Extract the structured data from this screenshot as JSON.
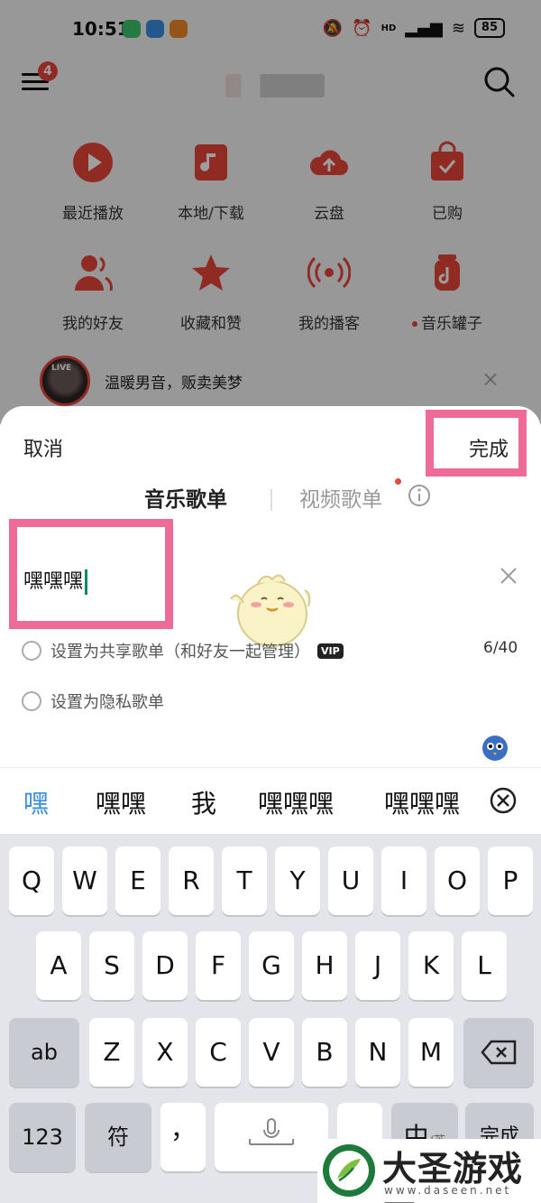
{
  "status_bar": {
    "time": "10:51",
    "battery": "85",
    "network": "HD"
  },
  "nav": {
    "badge_count": "4"
  },
  "grid": {
    "items": [
      {
        "label": "最近播放",
        "icon": "play-circle-icon"
      },
      {
        "label": "本地/下载",
        "icon": "music-note-folder-icon"
      },
      {
        "label": "云盘",
        "icon": "cloud-upload-icon"
      },
      {
        "label": "已购",
        "icon": "shopping-bag-check-icon"
      },
      {
        "label": "我的好友",
        "icon": "friends-icon"
      },
      {
        "label": "收藏和赞",
        "icon": "star-icon"
      },
      {
        "label": "我的播客",
        "icon": "broadcast-icon"
      },
      {
        "label": "音乐罐子",
        "icon": "music-jar-icon"
      }
    ]
  },
  "live": {
    "tag": "LIVE",
    "text": "温暖男音，贩卖美梦"
  },
  "sheet": {
    "cancel_label": "取消",
    "done_label": "完成",
    "tab_music": "音乐歌单",
    "tab_video": "视频歌单",
    "input_value": "嘿嘿嘿",
    "option_shared": "设置为共享歌单（和好友一起管理）",
    "vip_badge": "VIP",
    "option_private": "设置为隐私歌单",
    "char_count": "6/40"
  },
  "candidates": [
    "嘿",
    "嘿嘿",
    "我",
    "嘿嘿嘿",
    "嘿嘿嘿"
  ],
  "keyboard": {
    "row1": [
      "Q",
      "W",
      "E",
      "R",
      "T",
      "Y",
      "U",
      "I",
      "O",
      "P"
    ],
    "row2": [
      "A",
      "S",
      "D",
      "F",
      "G",
      "H",
      "J",
      "K",
      "L"
    ],
    "row3": [
      "Z",
      "X",
      "C",
      "V",
      "B",
      "N",
      "M"
    ],
    "shift_label": "ab",
    "num_label": "123",
    "symbol_label": "符",
    "comma_label": "，",
    "period_label": "。",
    "lang_label": "中",
    "lang_sub_label": "/英",
    "enter_label": "完成"
  },
  "watermark": {
    "title": "大圣游戏网",
    "url": "www.daseen.net"
  },
  "colors": {
    "accent_red": "#e8463b",
    "highlight_pink": "#ee6b98",
    "candidate_blue": "#3a8de0"
  }
}
